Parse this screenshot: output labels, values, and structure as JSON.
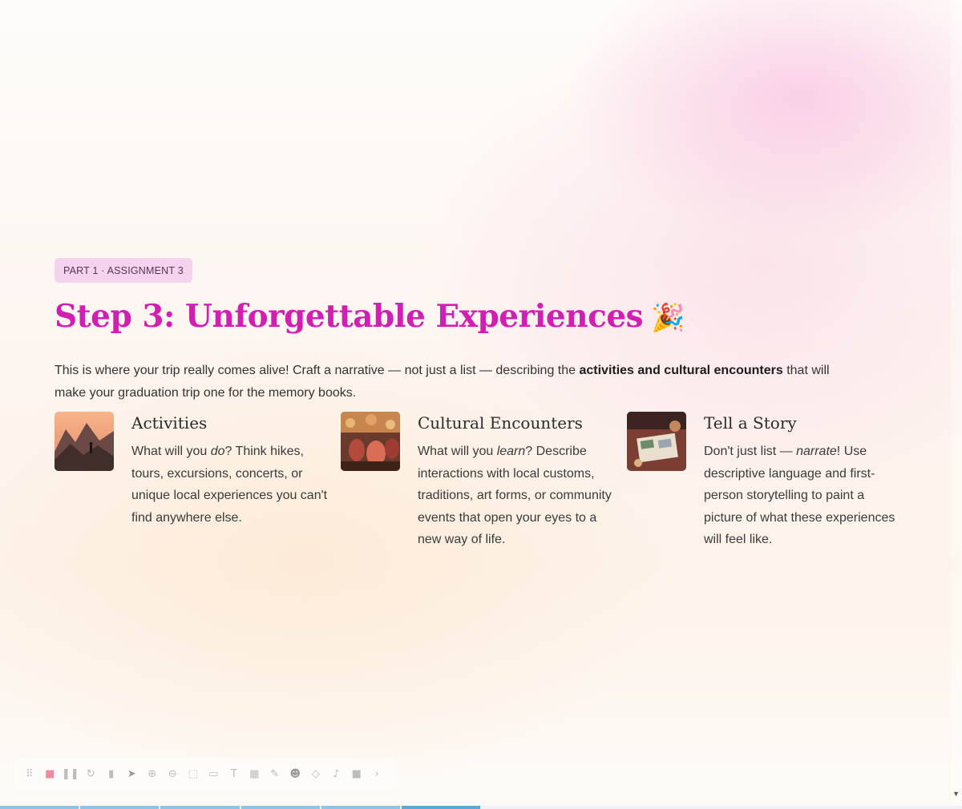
{
  "badge": "PART 1 · ASSIGNMENT 3",
  "title": "Step 3: Unforgettable Experiences",
  "title_emoji": "🎉",
  "intro": {
    "before": "This is where your trip really comes alive! Craft a narrative — not just a list — describing the ",
    "bold": "activities and cultural encounters",
    "after": " that will make your graduation trip one for the memory books."
  },
  "cards": [
    {
      "title": "Activities",
      "body_before": "What will you ",
      "body_em": "do",
      "body_after": "? Think hikes, tours, excursions, concerts, or unique local experiences you can't find anywhere else.",
      "image_icon": "mountain-hiker-photo"
    },
    {
      "title": "Cultural Encounters",
      "body_before": "What will you ",
      "body_em": "learn",
      "body_after": "? Describe interactions with local customs, traditions, art forms, or community events that open your eyes to a new way of life.",
      "image_icon": "festival-crowd-photo"
    },
    {
      "title": "Tell a Story",
      "body_before": "Don't just list — ",
      "body_em": "narrate",
      "body_after": "! Use descriptive language and first-person storytelling to paint a picture of what these experiences will feel like.",
      "image_icon": "travel-journal-photo"
    }
  ],
  "toolbar_icons": [
    "drag-handle-icon",
    "record-stop-icon",
    "pause-icon",
    "restart-icon",
    "delete-icon",
    "pointer-icon",
    "zoom-in-icon",
    "zoom-out-icon",
    "select-icon",
    "crop-icon",
    "text-icon",
    "grid-icon",
    "pen-icon",
    "emoji-icon",
    "eraser-icon",
    "mute-icon",
    "camera-icon",
    "chevron-icon"
  ],
  "progress": {
    "segments_total": 12,
    "current": 6
  }
}
